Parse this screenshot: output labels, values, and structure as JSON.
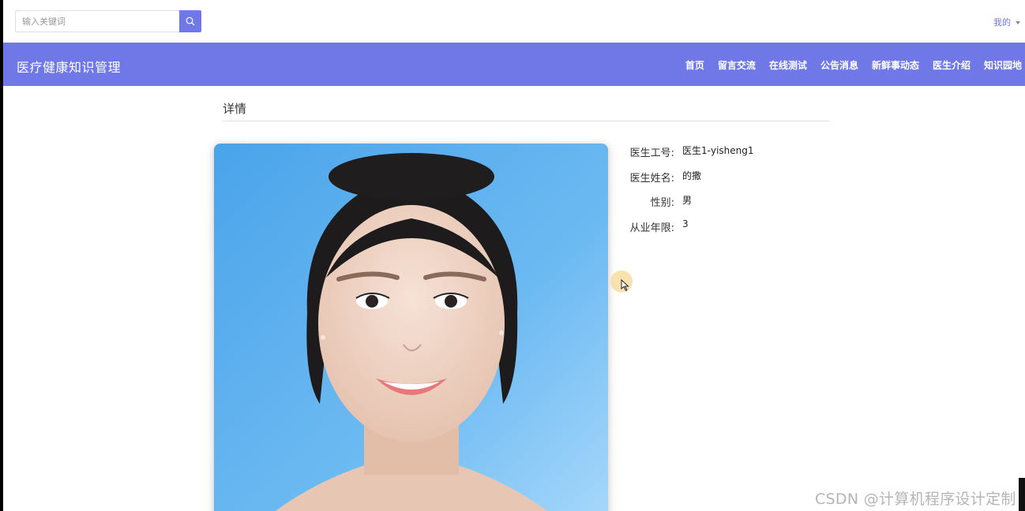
{
  "header": {
    "search": {
      "placeholder": "输入关键词",
      "value": ""
    },
    "search_icon": "search-icon",
    "user_menu_label": "我的"
  },
  "navbar": {
    "brand": "医疗健康知识管理",
    "items": [
      {
        "label": "首页"
      },
      {
        "label": "留言交流"
      },
      {
        "label": "在线测试"
      },
      {
        "label": "公告消息"
      },
      {
        "label": "新鲜事动态"
      },
      {
        "label": "医生介绍"
      },
      {
        "label": "知识园地"
      }
    ]
  },
  "detail": {
    "title": "详情",
    "fields": [
      {
        "label": "医生工号:",
        "value": "医生1-yisheng1"
      },
      {
        "label": "医生姓名:",
        "value": "的撒"
      },
      {
        "label": "性别:",
        "value": "男"
      },
      {
        "label": "从业年限:",
        "value": "3"
      }
    ]
  },
  "watermark": "CSDN @计算机程序设计定制",
  "colors": {
    "accent": "#6f78e6",
    "photo_bg": "#62b3ef"
  }
}
